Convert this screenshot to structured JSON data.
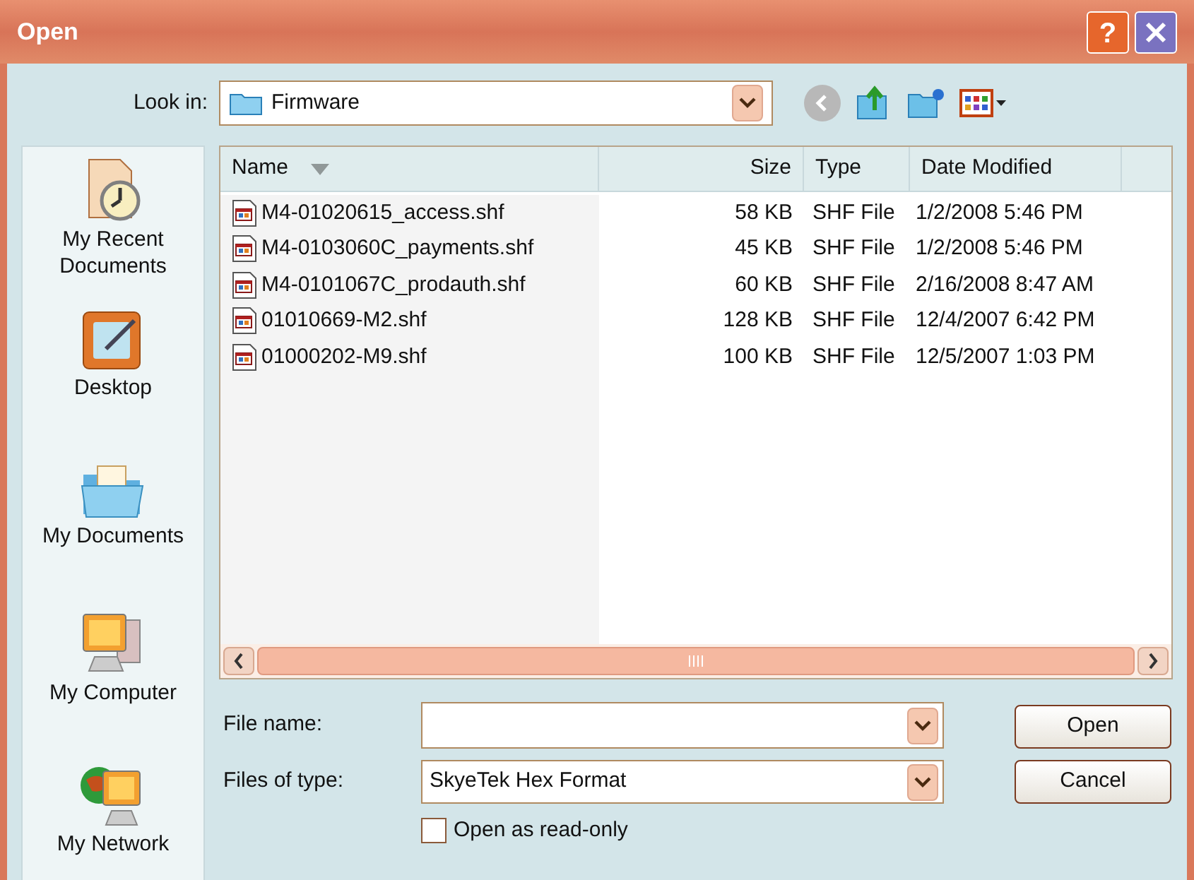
{
  "window": {
    "title": "Open",
    "help_button": "?"
  },
  "look_in": {
    "label": "Look in:",
    "value": "Firmware"
  },
  "places": [
    {
      "label": "My Recent Documents",
      "kind": "recent"
    },
    {
      "label": "Desktop",
      "kind": "desktop"
    },
    {
      "label": "My Documents",
      "kind": "documents"
    },
    {
      "label": "My Computer",
      "kind": "computer"
    },
    {
      "label": "My Network",
      "kind": "network"
    }
  ],
  "columns": [
    {
      "label": "Name",
      "sorted": true
    },
    {
      "label": "Size",
      "sorted": false
    },
    {
      "label": "Type",
      "sorted": false
    },
    {
      "label": "Date Modified",
      "sorted": false
    }
  ],
  "files": [
    {
      "name": "M4-01020615_access.shf",
      "size": "58 KB",
      "type": "SHF File",
      "modified": "1/2/2008 5:46 PM"
    },
    {
      "name": "M4-0103060C_payments.shf",
      "size": "45 KB",
      "type": "SHF File",
      "modified": "1/2/2008 5:46 PM"
    },
    {
      "name": "M4-0101067C_prodauth.shf",
      "size": "60 KB",
      "type": "SHF File",
      "modified": "2/16/2008 8:47 AM"
    },
    {
      "name": "01010669-M2.shf",
      "size": "128 KB",
      "type": "SHF File",
      "modified": "12/4/2007 6:42 PM"
    },
    {
      "name": "01000202-M9.shf",
      "size": "100 KB",
      "type": "SHF File",
      "modified": "12/5/2007 1:03 PM"
    }
  ],
  "file_name": {
    "label": "File name:"
  },
  "file_type": {
    "label": "Files of type:",
    "value": "SkyeTek Hex Format"
  },
  "read_only": {
    "label": "Open as read-only",
    "checked": false
  },
  "buttons": [
    {
      "label": "Open"
    },
    {
      "label": "Cancel"
    }
  ]
}
